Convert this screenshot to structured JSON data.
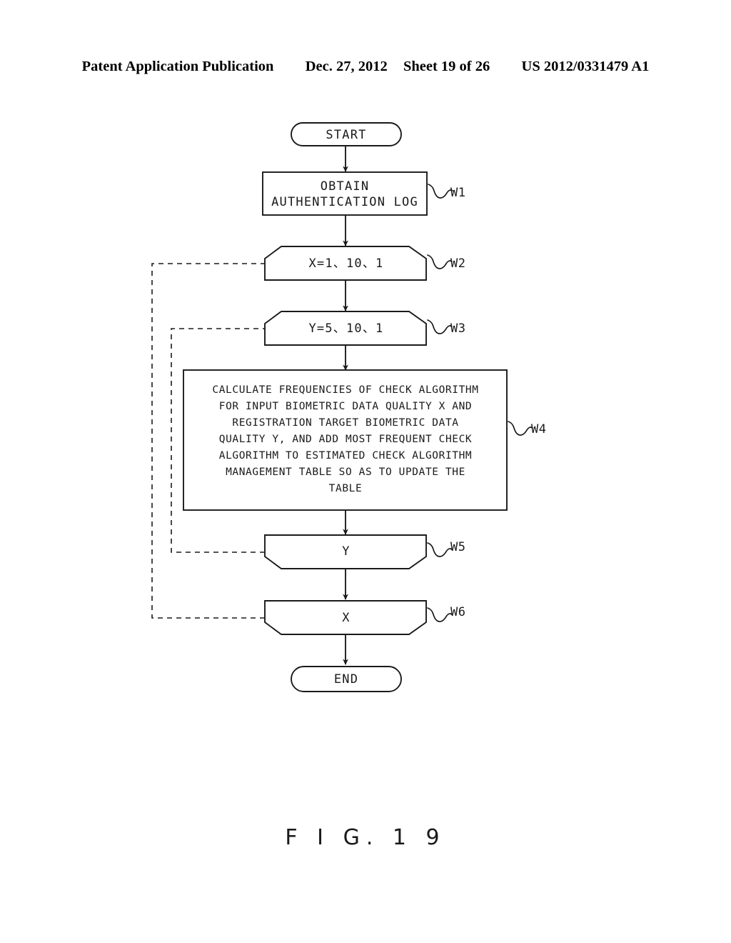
{
  "header": {
    "publication": "Patent Application Publication",
    "date": "Dec. 27, 2012",
    "sheet": "Sheet 19 of 26",
    "patent_number": "US 2012/0331479 A1"
  },
  "figure": {
    "caption": "F I G.  1 9"
  },
  "flowchart": {
    "type": "flowchart",
    "nodes": [
      {
        "id": "start",
        "shape": "terminator",
        "label": "START",
        "ref": ""
      },
      {
        "id": "w1",
        "shape": "process",
        "label_lines": [
          "OBTAIN",
          "AUTHENTICATION LOG"
        ],
        "ref": "W1"
      },
      {
        "id": "w2",
        "shape": "loop-start",
        "label": "X=1、10、1",
        "ref": "W2"
      },
      {
        "id": "w3",
        "shape": "loop-start",
        "label": "Y=5、10、1",
        "ref": "W3"
      },
      {
        "id": "w4",
        "shape": "process",
        "label_lines": [
          "CALCULATE FREQUENCIES OF CHECK ALGORITHM",
          "FOR INPUT BIOMETRIC DATA QUALITY X AND",
          "REGISTRATION TARGET BIOMETRIC DATA",
          "QUALITY Y, AND ADD MOST FREQUENT CHECK",
          "ALGORITHM TO ESTIMATED CHECK ALGORITHM",
          "MANAGEMENT TABLE SO AS TO UPDATE THE",
          "TABLE"
        ],
        "ref": "W4"
      },
      {
        "id": "w5",
        "shape": "loop-end",
        "label": "Y",
        "ref": "W5"
      },
      {
        "id": "w6",
        "shape": "loop-end",
        "label": "X",
        "ref": "W6"
      },
      {
        "id": "end",
        "shape": "terminator",
        "label": "END",
        "ref": ""
      }
    ],
    "edges": [
      {
        "from": "start",
        "to": "w1",
        "style": "solid-arrow"
      },
      {
        "from": "w1",
        "to": "w2",
        "style": "solid-arrow"
      },
      {
        "from": "w2",
        "to": "w3",
        "style": "solid-arrow"
      },
      {
        "from": "w3",
        "to": "w4",
        "style": "solid-arrow"
      },
      {
        "from": "w4",
        "to": "w5",
        "style": "solid-arrow"
      },
      {
        "from": "w5",
        "to": "w6",
        "style": "solid-arrow"
      },
      {
        "from": "w6",
        "to": "end",
        "style": "solid-arrow"
      },
      {
        "from": "w5",
        "to": "w3",
        "style": "dashed-loopback"
      },
      {
        "from": "w6",
        "to": "w2",
        "style": "dashed-loopback"
      }
    ]
  }
}
